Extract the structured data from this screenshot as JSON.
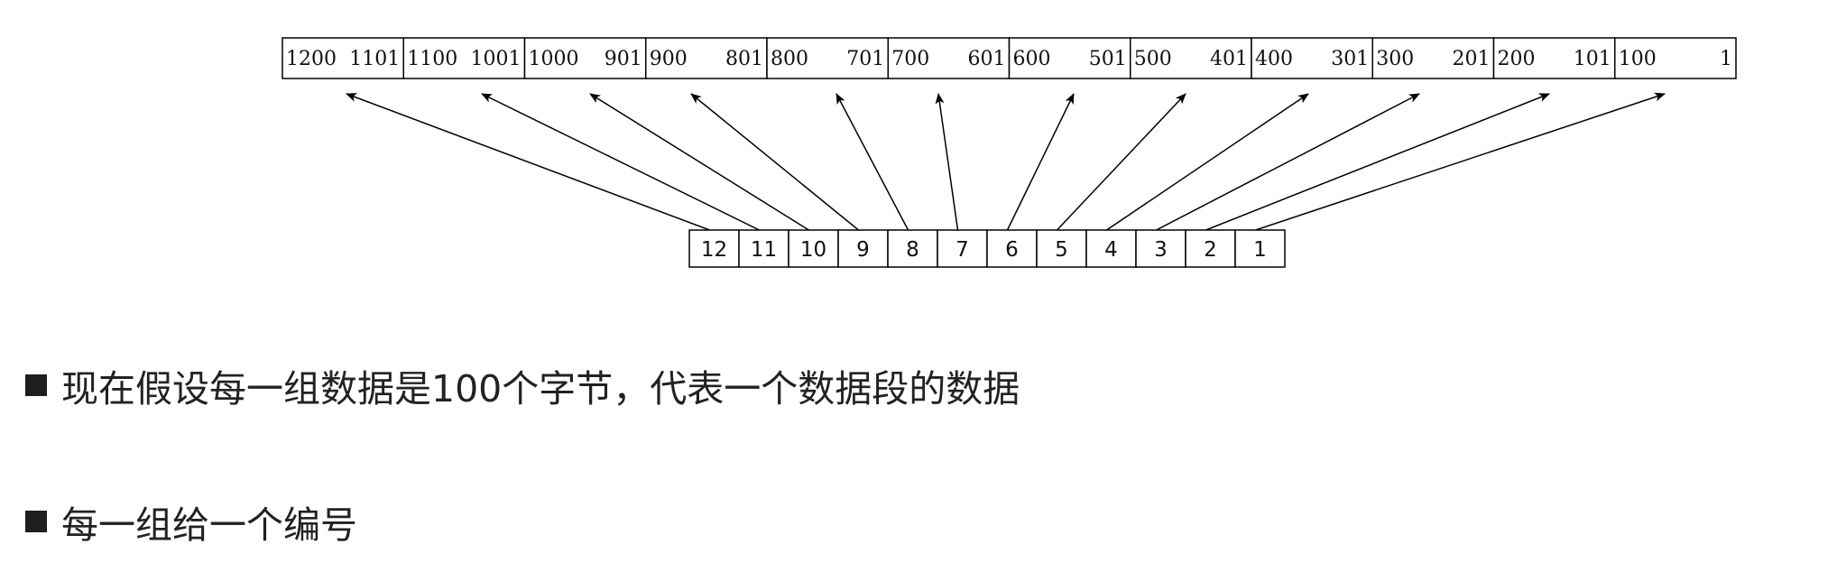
{
  "byte_groups": [
    {
      "high": "1200",
      "low": "1101"
    },
    {
      "high": "1100",
      "low": "1001"
    },
    {
      "high": "1000",
      "low": "901"
    },
    {
      "high": "900",
      "low": "801"
    },
    {
      "high": "800",
      "low": "701"
    },
    {
      "high": "700",
      "low": "601"
    },
    {
      "high": "600",
      "low": "501"
    },
    {
      "high": "500",
      "low": "401"
    },
    {
      "high": "400",
      "low": "301"
    },
    {
      "high": "300",
      "low": "201"
    },
    {
      "high": "200",
      "low": "101"
    },
    {
      "high": "100",
      "low": "1"
    }
  ],
  "segment_numbers": [
    "12",
    "11",
    "10",
    "9",
    "8",
    "7",
    "6",
    "5",
    "4",
    "3",
    "2",
    "1"
  ],
  "bullets": [
    "现在假设每一组数据是100个字节，代表一个数据段的数据",
    "每一组给一个编号"
  ],
  "colors": {
    "stroke": "#000000",
    "text": "#111111",
    "bullet": "#1e1e1e"
  }
}
